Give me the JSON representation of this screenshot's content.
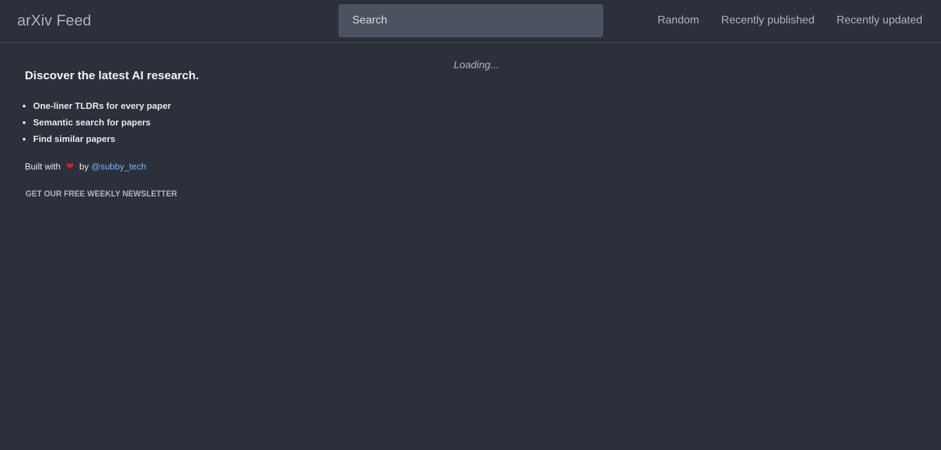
{
  "header": {
    "brand": "arXiv Feed",
    "search_placeholder": "Search",
    "nav": [
      {
        "label": "Random"
      },
      {
        "label": "Recently published"
      },
      {
        "label": "Recently updated"
      }
    ]
  },
  "sidebar": {
    "heading": "Discover the latest AI research.",
    "features": [
      "One-liner TLDRs for every paper",
      "Semantic search for papers",
      "Find similar papers"
    ],
    "built_with_prefix": "Built with",
    "heart": "❤",
    "built_by_word": "by",
    "author_handle": "@subby_tech",
    "newsletter_label": "GET OUR FREE WEEKLY NEWSLETTER"
  },
  "main": {
    "loading_text": "Loading..."
  },
  "colors": {
    "background": "#2b303b",
    "search_bg": "#4b5361",
    "muted_text": "#aeb4be",
    "link": "#7cb4ec",
    "heart": "#e21b2f"
  }
}
